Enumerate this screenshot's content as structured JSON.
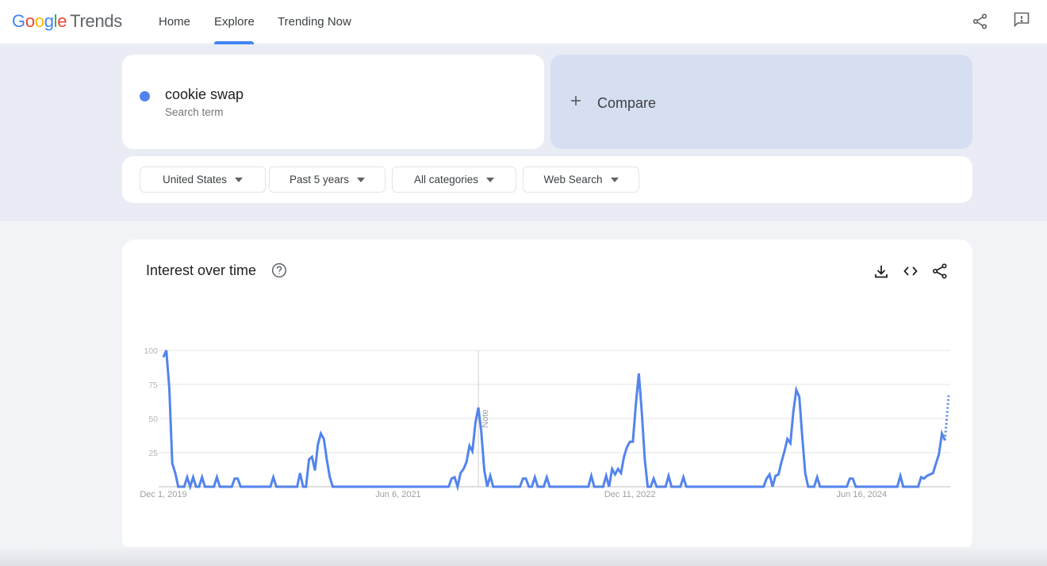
{
  "header": {
    "logo": {
      "google": [
        "G",
        "o",
        "o",
        "g",
        "l",
        "e"
      ],
      "product": "Trends"
    },
    "nav": [
      {
        "label": "Home",
        "active": false
      },
      {
        "label": "Explore",
        "active": true
      },
      {
        "label": "Trending Now",
        "active": false
      }
    ],
    "icons": [
      "share-icon",
      "feedback-icon"
    ]
  },
  "search": {
    "term": "cookie swap",
    "term_type": "Search term",
    "term_color": "#5384ed",
    "compare_label": "Compare"
  },
  "filters": [
    {
      "label": "United States"
    },
    {
      "label": "Past 5 years"
    },
    {
      "label": "All categories"
    },
    {
      "label": "Web Search"
    }
  ],
  "chart_section": {
    "title": "Interest over time",
    "actions": [
      "download-icon",
      "embed-icon",
      "share-icon"
    ],
    "note_label": "Note"
  },
  "chart_data": {
    "type": "line",
    "title": "Interest over time",
    "xlabel": "",
    "ylabel": "",
    "ylim": [
      0,
      100
    ],
    "yticks": [
      100,
      75,
      50,
      25
    ],
    "xtick_labels": [
      "Dec 1, 2019",
      "Jun 6, 2021",
      "Dec 11, 2022",
      "Jun 16, 2024"
    ],
    "xtick_week_index": [
      0,
      79,
      157,
      235
    ],
    "note_week_index": 106,
    "grid": true,
    "legend": "none",
    "series": [
      {
        "name": "cookie swap",
        "color": "#5384ed",
        "interval": "weekly",
        "start": "Dec 1, 2019",
        "partial_last_points": 1,
        "values": [
          95,
          100,
          72,
          17,
          10,
          0,
          0,
          0,
          7,
          0,
          7,
          0,
          0,
          7,
          0,
          0,
          0,
          0,
          7,
          0,
          0,
          0,
          0,
          0,
          6,
          6,
          0,
          0,
          0,
          0,
          0,
          0,
          0,
          0,
          0,
          0,
          0,
          7,
          0,
          0,
          0,
          0,
          0,
          0,
          0,
          0,
          10,
          0,
          0,
          20,
          22,
          12,
          31,
          39,
          35,
          20,
          7,
          0,
          0,
          0,
          0,
          0,
          0,
          0,
          0,
          0,
          0,
          0,
          0,
          0,
          0,
          0,
          0,
          0,
          0,
          0,
          0,
          0,
          0,
          0,
          0,
          0,
          0,
          0,
          0,
          0,
          0,
          0,
          0,
          0,
          0,
          0,
          0,
          0,
          0,
          0,
          0,
          6,
          7,
          0,
          10,
          13,
          18,
          30,
          26,
          47,
          58,
          40,
          12,
          0,
          8,
          0,
          0,
          0,
          0,
          0,
          0,
          0,
          0,
          0,
          0,
          6,
          6,
          0,
          0,
          7,
          0,
          0,
          0,
          7,
          0,
          0,
          0,
          0,
          0,
          0,
          0,
          0,
          0,
          0,
          0,
          0,
          0,
          0,
          8,
          0,
          0,
          0,
          0,
          8,
          0,
          13,
          9,
          13,
          10,
          22,
          29,
          33,
          33,
          60,
          83,
          55,
          20,
          0,
          0,
          6,
          0,
          0,
          0,
          0,
          8,
          0,
          0,
          0,
          0,
          7,
          0,
          0,
          0,
          0,
          0,
          0,
          0,
          0,
          0,
          0,
          0,
          0,
          0,
          0,
          0,
          0,
          0,
          0,
          0,
          0,
          0,
          0,
          0,
          0,
          0,
          0,
          0,
          6,
          9,
          0,
          8,
          9,
          18,
          26,
          35,
          32,
          55,
          71,
          66,
          37,
          10,
          0,
          0,
          0,
          7,
          0,
          0,
          0,
          0,
          0,
          0,
          0,
          0,
          0,
          0,
          6,
          6,
          0,
          0,
          0,
          0,
          0,
          0,
          0,
          0,
          0,
          0,
          0,
          0,
          0,
          0,
          0,
          8,
          0,
          0,
          0,
          0,
          0,
          0,
          7,
          6,
          8,
          9,
          10,
          17,
          24,
          39,
          34,
          67
        ]
      }
    ]
  }
}
